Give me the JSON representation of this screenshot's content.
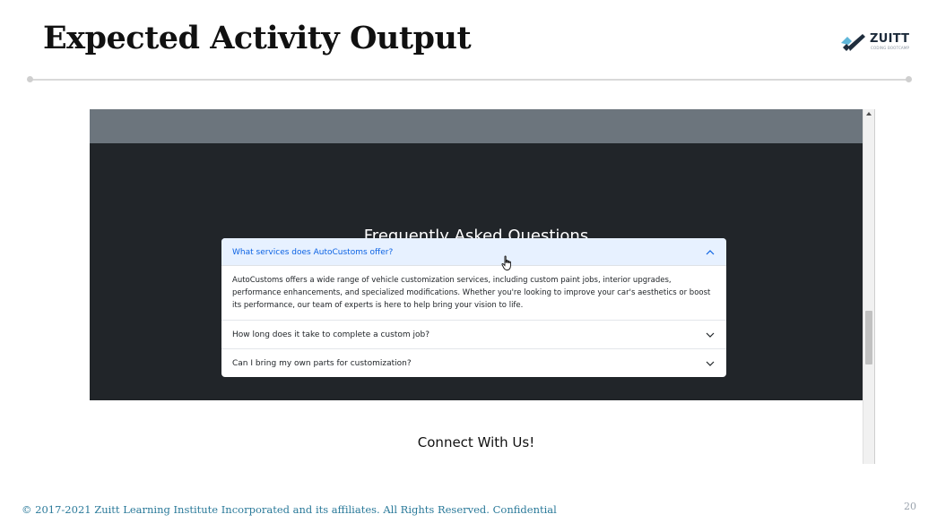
{
  "slide": {
    "title": "Expected Activity Output",
    "logo_text": "ZUITT",
    "logo_subtext": "CODING BOOTCAMP",
    "footer": "© 2017-2021 Zuitt Learning Institute Incorporated and its affiliates. All Rights Reserved. Confidential",
    "page_number": "20"
  },
  "browser": {
    "faq_heading": "Frequently Asked Questions",
    "faq_items": [
      {
        "question": "What services does AutoCustoms offer?",
        "expanded": true,
        "answer": "AutoCustoms offers a wide range of vehicle customization services, including custom paint jobs, interior upgrades, performance enhancements, and specialized modifications. Whether you're looking to improve your car's aesthetics or boost its performance, our team of experts is here to help bring your vision to life."
      },
      {
        "question": "How long does it take to complete a custom job?",
        "expanded": false
      },
      {
        "question": "Can I bring my own parts for customization?",
        "expanded": false
      }
    ],
    "connect_heading": "Connect With Us!"
  },
  "icons": {
    "chevron_up": "chevron-up-icon",
    "chevron_down": "chevron-down-icon",
    "cursor": "hand-pointer-icon",
    "logo": "zuitt-logo-icon"
  },
  "colors": {
    "dark_section": "#212529",
    "gray_band": "#6c757d",
    "accordion_active_bg": "#e7f1ff",
    "accordion_active_text": "#0c63e4",
    "footer_text": "#2b7a9a"
  }
}
